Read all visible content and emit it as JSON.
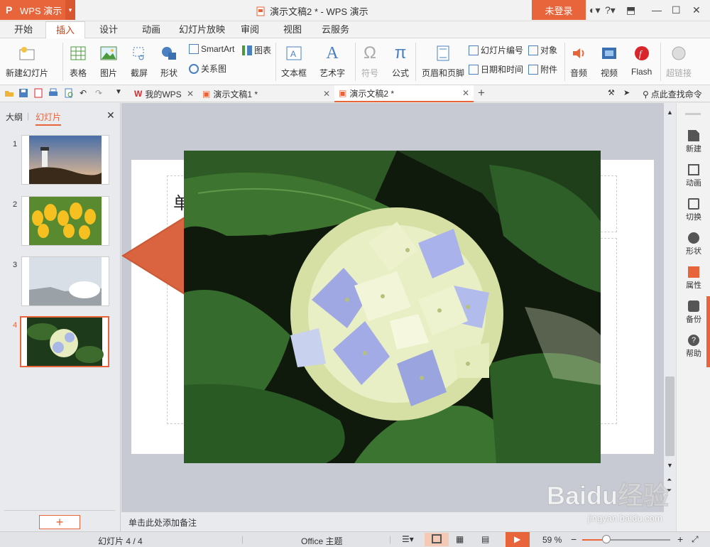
{
  "app": {
    "name": "WPS 演示",
    "window_title": "演示文稿2 * - WPS 演示",
    "login": "未登录"
  },
  "menu": [
    "开始",
    "插入",
    "设计",
    "动画",
    "幻灯片放映",
    "审阅",
    "视图",
    "云服务"
  ],
  "ribbon": {
    "new_slide": "新建幻灯片",
    "table": "表格",
    "picture": "图片",
    "screenshot": "截屏",
    "shape": "形状",
    "smartart": "SmartArt",
    "chart": "图表",
    "relation": "关系图",
    "textbox": "文本框",
    "wordart": "艺术字",
    "symbol": "符号",
    "formula": "公式",
    "header_footer": "页眉和页脚",
    "slide_number": "幻灯片编号",
    "date_time": "日期和时间",
    "object": "对象",
    "attachment": "附件",
    "audio": "音频",
    "video": "视频",
    "flash": "Flash",
    "hyperlink": "超链接"
  },
  "tabs": [
    {
      "label": "我的WPS"
    },
    {
      "label": "演示文稿1 *"
    },
    {
      "label": "演示文稿2 *"
    }
  ],
  "search_command": "点此查找命令",
  "left_panel": {
    "outline": "大纲",
    "slides": "幻灯片",
    "thumb_numbers": [
      "1",
      "2",
      "3",
      "4"
    ],
    "add": "+"
  },
  "slide": {
    "title_fragment": "单"
  },
  "notes_placeholder": "单击此处添加备注",
  "right_panel": [
    "新建",
    "动画",
    "切换",
    "形状",
    "属性",
    "备份",
    "帮助"
  ],
  "status": {
    "slide_info": "幻灯片 4 / 4",
    "theme": "Office 主题",
    "zoom": "59 %"
  },
  "watermark": {
    "brand": "Baidu经验",
    "url": "jingyan.baidu.com"
  },
  "colors": {
    "accent": "#e8643a",
    "arrow": "#d9643f"
  }
}
